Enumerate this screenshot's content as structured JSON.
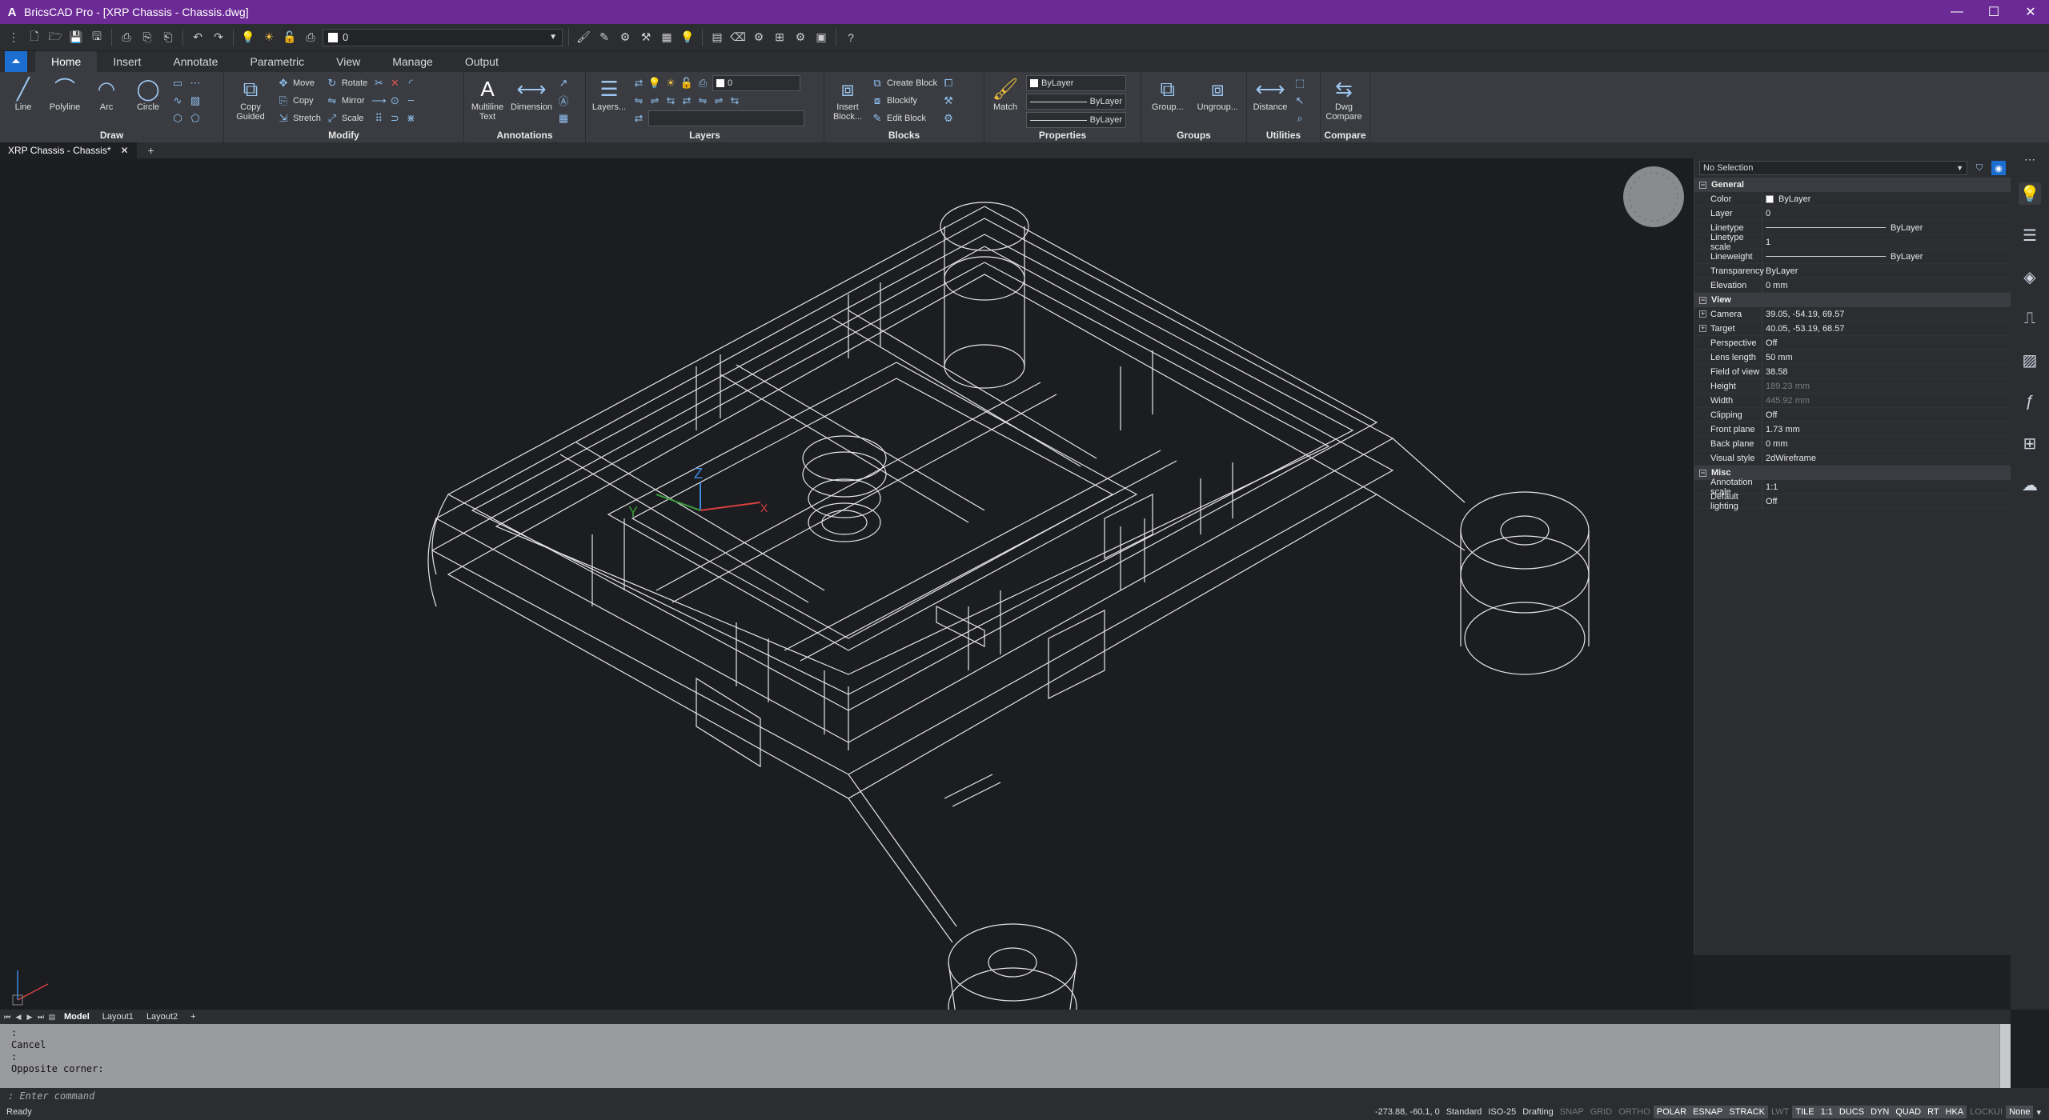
{
  "titlebar": {
    "logo": "A",
    "title": "BricsCAD Pro - [XRP Chassis - Chassis.dwg]",
    "minimize": "—",
    "maximize": "☐",
    "close": "✕"
  },
  "qat": {
    "current_layer": "0"
  },
  "ribbon_tabs": [
    "Home",
    "Insert",
    "Annotate",
    "Parametric",
    "View",
    "Manage",
    "Output"
  ],
  "ribbon": {
    "draw": {
      "title": "Draw",
      "line": "Line",
      "polyline": "Polyline",
      "arc": "Arc",
      "circle": "Circle"
    },
    "modify": {
      "title": "Modify",
      "copy_guided": "Copy Guided",
      "move": "Move",
      "copy": "Copy",
      "stretch": "Stretch",
      "rotate": "Rotate",
      "mirror": "Mirror",
      "scale": "Scale"
    },
    "annotations": {
      "title": "Annotations",
      "mtext": "Multiline Text",
      "dimension": "Dimension"
    },
    "layers": {
      "title": "Layers",
      "layers_btn": "Layers...",
      "current": "0"
    },
    "blocks": {
      "title": "Blocks",
      "insert": "Insert Block...",
      "create": "Create Block",
      "blockify": "Blockify",
      "edit": "Edit Block"
    },
    "properties": {
      "title": "Properties",
      "match": "Match",
      "color": "ByLayer",
      "linetype": "ByLayer",
      "lineweight": "ByLayer"
    },
    "groups": {
      "title": "Groups",
      "group": "Group...",
      "ungroup": "Ungroup..."
    },
    "utilities": {
      "title": "Utilities",
      "distance": "Distance"
    },
    "compare": {
      "title": "Compare",
      "dwg_compare": "Dwg Compare"
    }
  },
  "doc_tab": {
    "label": "XRP Chassis - Chassis*",
    "close": "✕",
    "new": "+"
  },
  "viewport": {
    "ucs_x": "X",
    "ucs_y": "Y",
    "ucs_z": "Z"
  },
  "properties_panel": {
    "selection": "No Selection",
    "sections": [
      {
        "name": "General",
        "rows": [
          {
            "k": "Color",
            "v": "ByLayer"
          },
          {
            "k": "Layer",
            "v": "0"
          },
          {
            "k": "Linetype",
            "v": "ByLayer"
          },
          {
            "k": "Linetype scale",
            "v": "1"
          },
          {
            "k": "Lineweight",
            "v": "ByLayer"
          },
          {
            "k": "Transparency",
            "v": "ByLayer"
          },
          {
            "k": "Elevation",
            "v": "0 mm"
          }
        ]
      },
      {
        "name": "View",
        "rows": [
          {
            "k": "Camera",
            "v": "39.05, -54.19, 69.57"
          },
          {
            "k": "Target",
            "v": "40.05, -53.19, 68.57"
          },
          {
            "k": "Perspective",
            "v": "Off"
          },
          {
            "k": "Lens length",
            "v": "50 mm"
          },
          {
            "k": "Field of view",
            "v": "38.58"
          },
          {
            "k": "Height",
            "v": "189.23 mm"
          },
          {
            "k": "Width",
            "v": "445.92 mm"
          },
          {
            "k": "Clipping",
            "v": "Off"
          },
          {
            "k": "Front plane",
            "v": "1.73 mm"
          },
          {
            "k": "Back plane",
            "v": "0 mm"
          },
          {
            "k": "Visual style",
            "v": "2dWireframe"
          }
        ]
      },
      {
        "name": "Misc",
        "rows": [
          {
            "k": "Annotation scale",
            "v": "1:1"
          },
          {
            "k": "Default lighting",
            "v": "Off"
          }
        ]
      }
    ]
  },
  "layout_tabs": [
    "Model",
    "Layout1",
    "Layout2"
  ],
  "command_history": [
    ":",
    "Cancel",
    ":",
    "Opposite corner:"
  ],
  "command_prompt": ": Enter command",
  "status": {
    "ready": "Ready",
    "coords": "-273.88, -60.1, 0",
    "text_style": "Standard",
    "dim_style": "ISO-25",
    "workspace": "Drafting",
    "toggles": [
      {
        "label": "SNAP",
        "on": false
      },
      {
        "label": "GRID",
        "on": false
      },
      {
        "label": "ORTHO",
        "on": false
      },
      {
        "label": "POLAR",
        "on": true
      },
      {
        "label": "ESNAP",
        "on": true
      },
      {
        "label": "STRACK",
        "on": true
      },
      {
        "label": "LWT",
        "on": false
      },
      {
        "label": "TILE",
        "on": true
      },
      {
        "label": "1:1",
        "on": true
      },
      {
        "label": "DUCS",
        "on": true
      },
      {
        "label": "DYN",
        "on": true
      },
      {
        "label": "QUAD",
        "on": true
      },
      {
        "label": "RT",
        "on": true
      },
      {
        "label": "HKA",
        "on": true
      },
      {
        "label": "LOCKUI",
        "on": false
      },
      {
        "label": "None",
        "on": true
      }
    ]
  }
}
